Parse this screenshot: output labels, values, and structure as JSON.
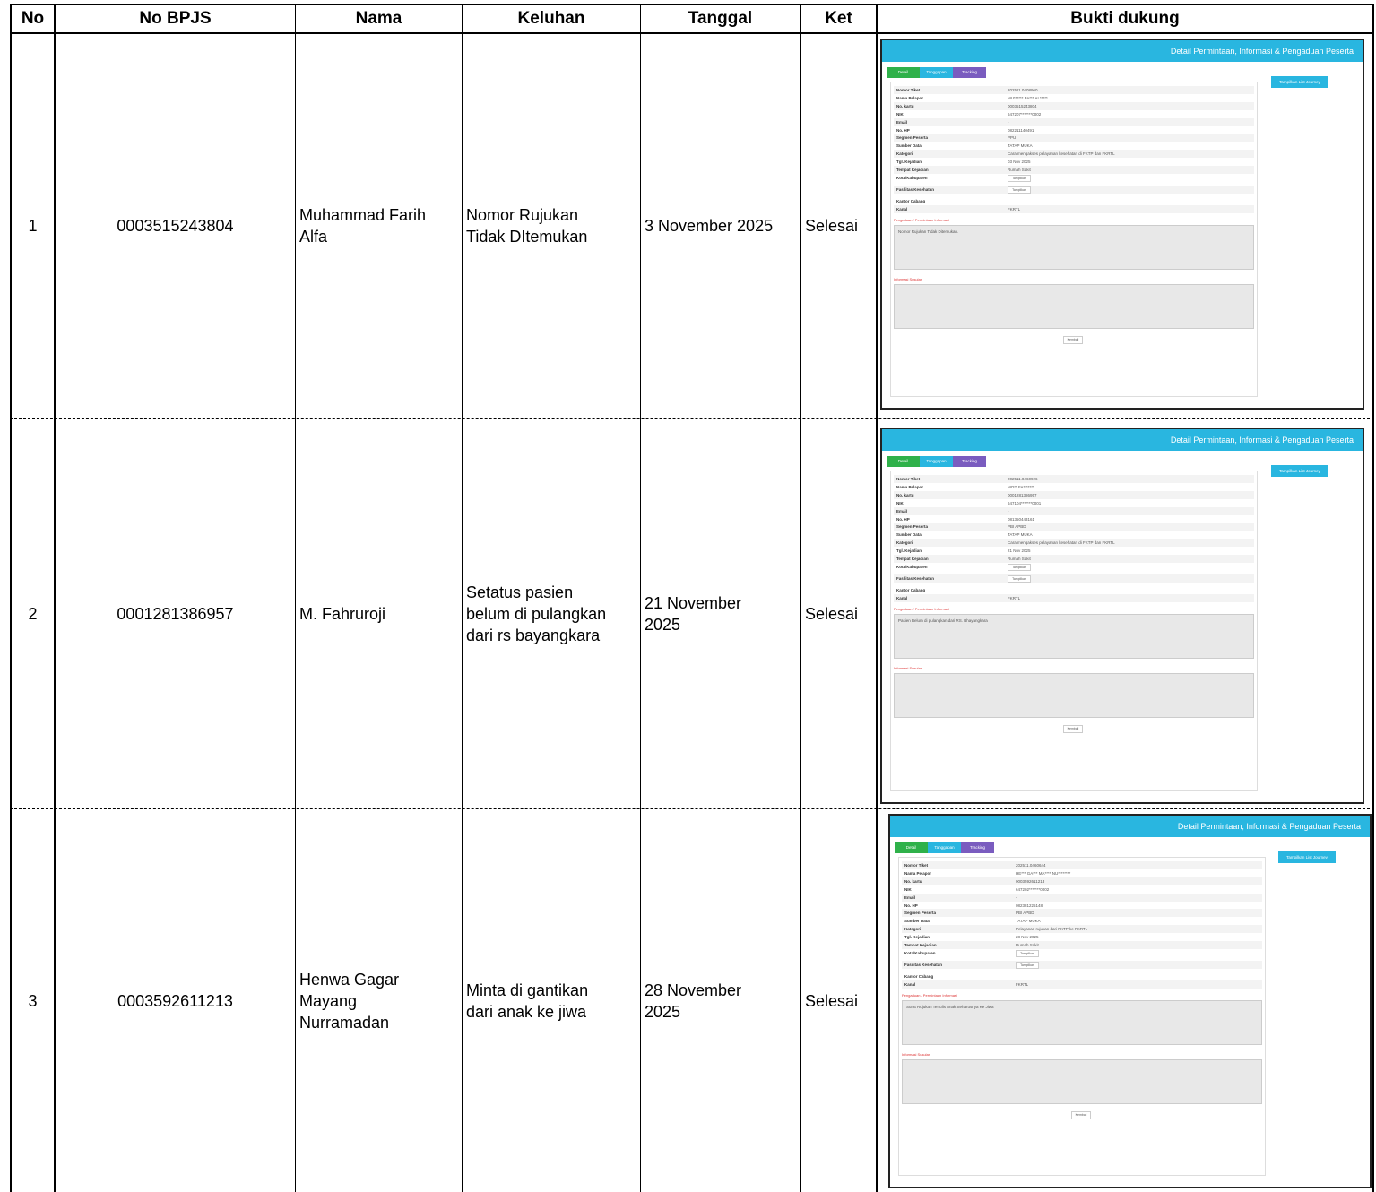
{
  "headers": {
    "no": "No",
    "bpjs": "No BPJS",
    "nama": "Nama",
    "keluhan": "Keluhan",
    "tanggal": "Tanggal",
    "ket": "Ket",
    "bukti": "Bukti dukung"
  },
  "rows": [
    {
      "no": "1",
      "bpjs": "0003515243804",
      "nama_lines": [
        "Muhammad Farih",
        "Alfa"
      ],
      "keluhan_lines": [
        "Nomor Rujukan",
        "Tidak DItemukan"
      ],
      "tanggal_lines": [
        "3 November 2025"
      ],
      "ket": "Selesai",
      "bukti": {
        "title": "Detail Permintaan, Informasi & Pengaduan Peserta",
        "tabs": [
          "Detail",
          "Tanggapan",
          "Tracking"
        ],
        "journey_button": "Tampilkan List Journey",
        "fields": [
          {
            "label": "Nomor Tiket",
            "value": "202511.0408960"
          },
          {
            "label": "Nama Pelapor",
            "value": "MU****** FA*** AL*****"
          },
          {
            "label": "No. kartu",
            "value": "0003515243804"
          },
          {
            "label": "NIK",
            "value": "647207*******0002"
          },
          {
            "label": "Email",
            "value": "-"
          },
          {
            "label": "No. HP",
            "value": "082211140491"
          },
          {
            "label": "Segmen Peserta",
            "value": "PPU"
          },
          {
            "label": "Sumber Data",
            "value": "TATAP MUKA"
          },
          {
            "label": "Kategori",
            "value": "Cara mengakses pelayanan kesehatan di FKTP dan FKRTL"
          },
          {
            "label": "Tgl. Kejadian",
            "value": "03 Nov 2025"
          },
          {
            "label": "Tempat Kejadian",
            "value": "Rumah Sakit"
          },
          {
            "label": "Kota/Kabupaten",
            "value": "",
            "button": "Tampilkan"
          },
          {
            "label": "Fasilitas Kesehatan",
            "value": "",
            "button": "Tampilkan"
          },
          {
            "label": "Kantor Cabang",
            "value": ""
          },
          {
            "label": "Kanal",
            "value": "FKRTL"
          }
        ],
        "section_pengaduan": "Pengaduan / Permintaan Informasi",
        "pengaduan_text": "Nomor Rujukan Tidak Ditemukan.",
        "section_informasi": "Informasi Susulan",
        "informasi_text": "",
        "kembali": "Kembali"
      }
    },
    {
      "no": "2",
      "bpjs": "0001281386957",
      "nama_lines": [
        "M. Fahruroji"
      ],
      "keluhan_lines": [
        "Setatus pasien",
        "belum di pulangkan",
        "dari rs bayangkara"
      ],
      "tanggal_lines": [
        "21 November",
        "2025"
      ],
      "ket": "Selesai",
      "bukti": {
        "title": "Detail Permintaan, Informasi & Pengaduan Peserta",
        "tabs": [
          "Detail",
          "Tanggapan",
          "Tracking"
        ],
        "journey_button": "Tampilkan List Journey",
        "fields": [
          {
            "label": "Nomor Tiket",
            "value": "202511.0460926"
          },
          {
            "label": "Nama Pelapor",
            "value": "MO** FA*******"
          },
          {
            "label": "No. kartu",
            "value": "0001281386957"
          },
          {
            "label": "NIK",
            "value": "647104*******0001"
          },
          {
            "label": "Email",
            "value": "-"
          },
          {
            "label": "No. HP",
            "value": "081350443161"
          },
          {
            "label": "Segmen Peserta",
            "value": "PBI APBD"
          },
          {
            "label": "Sumber Data",
            "value": "TATAP MUKA"
          },
          {
            "label": "Kategori",
            "value": "Cara mengakses pelayanan kesehatan di FKTP dan FKRTL"
          },
          {
            "label": "Tgl. Kejadian",
            "value": "21 Nov 2025"
          },
          {
            "label": "Tempat Kejadian",
            "value": "Rumah Sakit"
          },
          {
            "label": "Kota/Kabupaten",
            "value": "",
            "button": "Tampilkan"
          },
          {
            "label": "Fasilitas Kesehatan",
            "value": "",
            "button": "Tampilkan"
          },
          {
            "label": "Kantor Cabang",
            "value": ""
          },
          {
            "label": "Kanal",
            "value": "FKRTL"
          }
        ],
        "section_pengaduan": "Pengaduan / Permintaan Informasi",
        "pengaduan_text": "Pasien Belum di pulangkan dari RS. Bhayangkara",
        "section_informasi": "Informasi Susulan",
        "informasi_text": "",
        "kembali": "Kembali"
      }
    },
    {
      "no": "3",
      "bpjs": "0003592611213",
      "nama_lines": [
        "Henwa Gagar",
        "Mayang",
        "Nurramadan"
      ],
      "keluhan_lines": [
        "Minta di gantikan",
        "dari anak ke jiwa"
      ],
      "tanggal_lines": [
        "28 November",
        "2025"
      ],
      "ket": "Selesai",
      "bukti": {
        "title": "Detail Permintaan, Informasi & Pengaduan Peserta",
        "tabs": [
          "Detail",
          "Tanggapan",
          "Tracking"
        ],
        "journey_button": "Tampilkan List Journey",
        "fields": [
          {
            "label": "Nomor Tiket",
            "value": "202511.0460644"
          },
          {
            "label": "Nama Pelapor",
            "value": "HE*** GA*** MA**** NU********"
          },
          {
            "label": "No. kartu",
            "value": "0003592611213"
          },
          {
            "label": "NIK",
            "value": "647202*******0002"
          },
          {
            "label": "Email",
            "value": "-"
          },
          {
            "label": "No. HP",
            "value": "082381225148"
          },
          {
            "label": "Segmen Peserta",
            "value": "PBI APBD"
          },
          {
            "label": "Sumber Data",
            "value": "TATAP MUKA"
          },
          {
            "label": "Kategori",
            "value": "Pelayanan rujukan dari FKTP ke FKRTL"
          },
          {
            "label": "Tgl. Kejadian",
            "value": "28 Nov 2025"
          },
          {
            "label": "Tempat Kejadian",
            "value": "Rumah Sakit"
          },
          {
            "label": "Kota/Kabupaten",
            "value": "",
            "button": "Tampilkan"
          },
          {
            "label": "Fasilitas Kesehatan",
            "value": "",
            "button": "Tampilkan"
          },
          {
            "label": "Kantor Cabang",
            "value": ""
          },
          {
            "label": "Kanal",
            "value": "FKRTL"
          }
        ],
        "section_pengaduan": "Pengaduan / Permintaan Informasi",
        "pengaduan_text": "Surat Rujukan Tertulis Anak Seharusnya Ke Jiwa",
        "section_informasi": "Informasi Susulan",
        "informasi_text": "",
        "kembali": "Kembali"
      }
    }
  ]
}
